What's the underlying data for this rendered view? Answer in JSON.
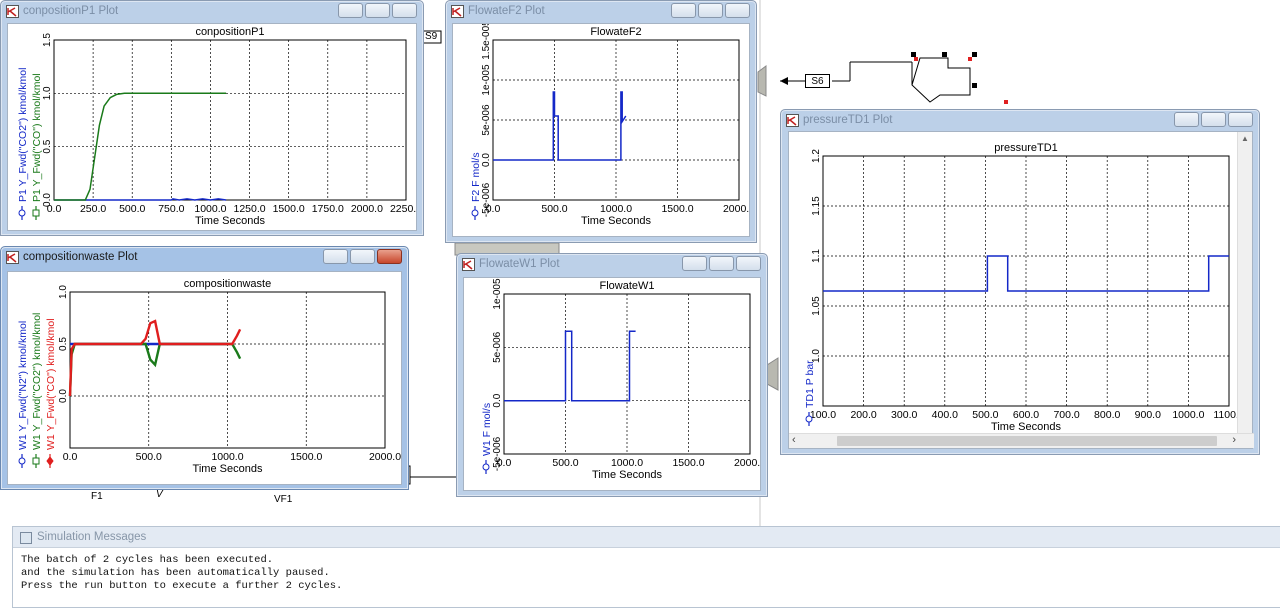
{
  "flowsheet": {
    "stream_s9": "S9",
    "stream_s6": "S6",
    "label_f1": "F1",
    "label_v": "V",
    "label_vf1": "VF1"
  },
  "windows": {
    "compP1": {
      "title": "conpositionP1 Plot",
      "plot_title": "conpositionP1",
      "xlabel": "Time Seconds",
      "ylabels": [
        "P1 Y_Fwd(\"CO2\") kmol/kmol",
        "P1 Y_Fwd(\"CO\") kmol/kmol"
      ],
      "xticks": [
        "0.0",
        "250.0",
        "500.0",
        "750.0",
        "1000.0",
        "1250.0",
        "1500.0",
        "1750.0",
        "2000.0",
        "2250.0"
      ],
      "yticks": [
        "0.0",
        "0.5",
        "1.0",
        "1.5"
      ]
    },
    "flowF2": {
      "title": "FlowateF2 Plot",
      "plot_title": "FlowateF2",
      "xlabel": "Time Seconds",
      "ylabels": [
        "F2 F mol/s"
      ],
      "xticks": [
        "0.0",
        "500.0",
        "1000.0",
        "1500.0",
        "2000.0"
      ],
      "yticks": [
        "-5e-006",
        "0.0",
        "5e-006",
        "1e-005",
        "1.5e-005"
      ]
    },
    "waste": {
      "title": "compositionwaste Plot",
      "plot_title": "compositionwaste",
      "xlabel": "Time Seconds",
      "ylabels": [
        "W1 Y_Fwd(\"N2\") kmol/kmol",
        "W1 Y_Fwd(\"CO2\") kmol/kmol",
        "W1 Y_Fwd(\"CO\") kmol/kmol"
      ],
      "xticks": [
        "0.0",
        "500.0",
        "1000.0",
        "1500.0",
        "2000.0"
      ],
      "yticks": [
        "0.0",
        "0.5",
        "1.0"
      ]
    },
    "flowW1": {
      "title": "FlowateW1 Plot",
      "plot_title": "FlowateW1",
      "xlabel": "Time Seconds",
      "ylabels": [
        "W1 F mol/s"
      ],
      "xticks": [
        "0.0",
        "500.0",
        "1000.0",
        "1500.0",
        "2000.0"
      ],
      "yticks": [
        "-5e-006",
        "0.0",
        "5e-006",
        "1e-005"
      ]
    },
    "pressure": {
      "title": "pressureTD1 Plot",
      "plot_title": "pressureTD1",
      "xlabel": "Time Seconds",
      "ylabels": [
        "TD1 P bar"
      ],
      "xticks": [
        "100.0",
        "200.0",
        "300.0",
        "400.0",
        "500.0",
        "600.0",
        "700.0",
        "800.0",
        "900.0",
        "1000.0",
        "1100.0"
      ],
      "yticks": [
        "1.0",
        "1.05",
        "1.1",
        "1.15",
        "1.2"
      ]
    }
  },
  "chart_data": [
    {
      "type": "line",
      "title": "conpositionP1",
      "xlabel": "Time Seconds",
      "xlim": [
        0,
        2250
      ],
      "ylim": [
        0,
        1.5
      ],
      "series": [
        {
          "name": "P1 Y_Fwd(\"CO2\") kmol/kmol",
          "color": "#1428c8",
          "x": [
            0,
            750,
            760,
            800,
            850,
            900,
            950,
            1000,
            1050,
            1100
          ],
          "y": [
            0.0,
            0.0,
            0.01,
            0.0,
            0.01,
            0.0,
            0.01,
            0.0,
            0.01,
            0.0
          ]
        },
        {
          "name": "P1 Y_Fwd(\"CO\") kmol/kmol",
          "color": "#1a7a1a",
          "x": [
            0,
            200,
            230,
            260,
            290,
            320,
            360,
            400,
            450,
            1100
          ],
          "y": [
            0.0,
            0.0,
            0.1,
            0.4,
            0.7,
            0.88,
            0.96,
            0.99,
            1.0,
            1.0
          ]
        }
      ]
    },
    {
      "type": "line",
      "title": "FlowateF2",
      "xlabel": "Time Seconds",
      "xlim": [
        0,
        2000
      ],
      "ylim": [
        -5e-06,
        1.5e-05
      ],
      "series": [
        {
          "name": "F2 F mol/s",
          "color": "#1428c8",
          "x": [
            0,
            490,
            490,
            500,
            500,
            530,
            530,
            1040,
            1040,
            1050,
            1050,
            1080
          ],
          "y": [
            0,
            0,
            8.5e-06,
            8.5e-06,
            5.5e-06,
            5.5e-06,
            0,
            0,
            8.5e-06,
            8.5e-06,
            4.8e-06,
            5.5e-06
          ]
        }
      ]
    },
    {
      "type": "line",
      "title": "compositionwaste",
      "xlabel": "Time Seconds",
      "xlim": [
        0,
        2000
      ],
      "ylim": [
        -0.5,
        1.0
      ],
      "series": [
        {
          "name": "W1 Y_Fwd(\"N2\") kmol/kmol",
          "color": "#1428c8",
          "x": [
            0,
            1000
          ],
          "y": [
            0.5,
            0.5
          ]
        },
        {
          "name": "W1 Y_Fwd(\"CO2\") kmol/kmol",
          "color": "#1a7a1a",
          "x": [
            0,
            10,
            30,
            450,
            480,
            510,
            540,
            570,
            1030,
            1060,
            1080
          ],
          "y": [
            0.0,
            0.4,
            0.5,
            0.5,
            0.5,
            0.35,
            0.3,
            0.5,
            0.5,
            0.42,
            0.36
          ]
        },
        {
          "name": "W1 Y_Fwd(\"CO\") kmol/kmol",
          "color": "#e01e1e",
          "x": [
            0,
            10,
            30,
            450,
            480,
            510,
            540,
            570,
            1030,
            1060,
            1080
          ],
          "y": [
            0.0,
            0.45,
            0.5,
            0.5,
            0.55,
            0.7,
            0.72,
            0.5,
            0.5,
            0.58,
            0.64
          ]
        }
      ]
    },
    {
      "type": "line",
      "title": "FlowateW1",
      "xlabel": "Time Seconds",
      "xlim": [
        0,
        2000
      ],
      "ylim": [
        -5e-06,
        1e-05
      ],
      "series": [
        {
          "name": "W1 F mol/s",
          "color": "#1428c8",
          "x": [
            0,
            500,
            500,
            550,
            550,
            1020,
            1020,
            1070
          ],
          "y": [
            0,
            0,
            6.5e-06,
            6.5e-06,
            0,
            0,
            6.5e-06,
            6.5e-06
          ]
        }
      ]
    },
    {
      "type": "line",
      "title": "pressureTD1",
      "xlabel": "Time Seconds",
      "xlim": [
        100,
        1100
      ],
      "ylim": [
        0.95,
        1.2
      ],
      "series": [
        {
          "name": "TD1 P bar",
          "color": "#1428c8",
          "x": [
            100,
            505,
            505,
            555,
            555,
            1050,
            1050,
            1100
          ],
          "y": [
            1.065,
            1.065,
            1.1,
            1.1,
            1.065,
            1.065,
            1.1,
            1.1
          ]
        }
      ]
    }
  ],
  "messages": {
    "title": "Simulation Messages",
    "lines": [
      "The batch of 2 cycles has been executed.",
      "and the simulation has been automatically paused.",
      "Press the run button to execute a further 2 cycles."
    ]
  }
}
